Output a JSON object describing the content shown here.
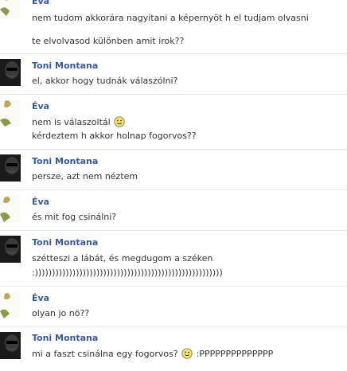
{
  "colors": {
    "name": "#3b5998",
    "text": "#333333",
    "divider": "#e9e9e9"
  },
  "icons": {
    "smiley": "smiley-icon",
    "avatar_toni": "toni-montana-avatar",
    "avatar_eva": "eva-avatar"
  },
  "messages": [
    {
      "sender": "Éva",
      "lines": [
        "nem tudom akkorára nagyitani a képernyöt h el tudjam olvasni",
        "te elvolvasod különben amit irok??"
      ]
    },
    {
      "sender": "Toni Montana",
      "lines": [
        "el, akkor hogy tudnák válaszólni?"
      ]
    },
    {
      "sender": "Éva",
      "lines": [
        "nem is válaszoltál",
        "kérdeztem h akkor holnap fogorvos??"
      ]
    },
    {
      "sender": "Toni Montana",
      "lines": [
        "persze, azt nem néztem"
      ]
    },
    {
      "sender": "Éva",
      "lines": [
        "és mit fog csinálni?"
      ]
    },
    {
      "sender": "Toni Montana",
      "lines": [
        "szétteszi a lábát, és megdugom a széken",
        ":)))))))))))))))))))))))))))))))))))))))))))))))))))))))"
      ]
    },
    {
      "sender": "Éva",
      "lines": [
        "olyan jo nö??"
      ]
    },
    {
      "sender": "Toni Montana",
      "lines": [
        "mi a faszt csinálna egy fogorvos?",
        ":PPPPPPPPPPPPPP"
      ]
    }
  ]
}
